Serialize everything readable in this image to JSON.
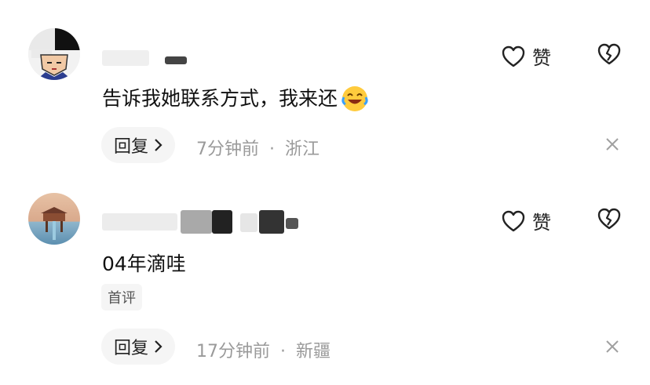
{
  "comments": [
    {
      "text": "告诉我她联系方式，我来还",
      "like_label": "赞",
      "reply_label": "回复",
      "time": "7分钟前",
      "separator": "·",
      "location": "浙江"
    },
    {
      "text": "04年滴哇",
      "badge": "首评",
      "like_label": "赞",
      "reply_label": "回复",
      "time": "17分钟前",
      "separator": "·",
      "location": "新疆"
    }
  ],
  "icons": {
    "like": "heart-outline-icon",
    "dislike": "broken-heart-icon",
    "reply_arrow": "chevron-right-icon",
    "close": "close-icon",
    "emoji": "laughing-crying-emoji"
  }
}
